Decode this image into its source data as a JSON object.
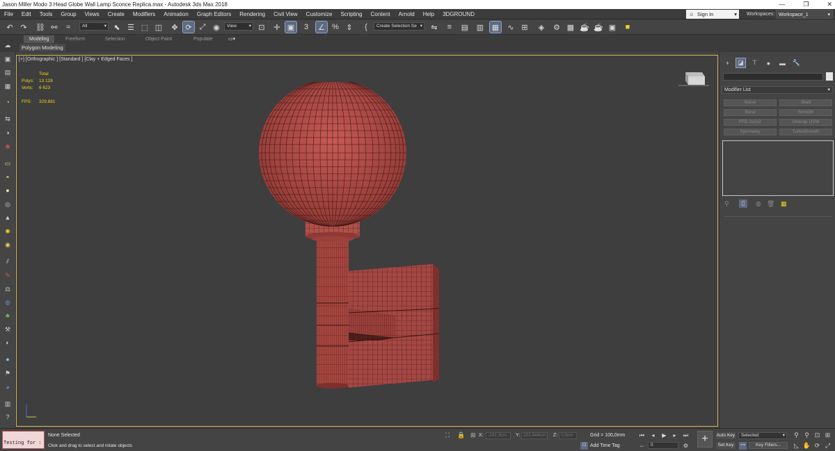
{
  "app": {
    "title": "Jason Miller Modo 3 Head Globe Wall Lamp Sconce Replica.max - Autodesk 3ds Max 2018",
    "window_controls": [
      "—",
      "❐",
      "✕"
    ]
  },
  "menu": [
    "File",
    "Edit",
    "Tools",
    "Group",
    "Views",
    "Create",
    "Modifiers",
    "Animation",
    "Graph Editors",
    "Rendering",
    "Civil View",
    "Customize",
    "Scripting",
    "Content",
    "Arnold",
    "Help",
    "3DGROUND"
  ],
  "account": {
    "signin": "Sign In",
    "workspaces_label": "Workspaces:",
    "workspace": "Workspace_1"
  },
  "toolbar": {
    "filter": "All",
    "refcoord": "View",
    "selection_set": "Create Selection Se",
    "icons": [
      "undo-icon",
      "redo-icon",
      "link-icon",
      "unlink-icon",
      "bind-spacewarp-icon",
      "select-icon",
      "select-by-name-icon",
      "rect-region-icon",
      "window-crossing-icon",
      "select-move-icon",
      "select-rotate-icon",
      "select-scale-icon",
      "placement-icon",
      "pivot-icon",
      "keyboard-shortcut-icon",
      "snap-icon",
      "angle-snap-icon",
      "percent-snap-icon",
      "spinner-snap-icon",
      "edit-named-sets-icon",
      "mirror-icon",
      "align-icon",
      "scene-explorer-icon",
      "layer-explorer-icon",
      "ribbon-icon",
      "curve-editor-icon",
      "schematic-icon",
      "material-editor-icon",
      "render-setup-icon",
      "render-frame-icon",
      "render-icon",
      "arnold-icon"
    ]
  },
  "ribbon": {
    "tabs": [
      "Modeling",
      "Freeform",
      "Selection",
      "Object Paint",
      "Populate"
    ],
    "active": "Modeling",
    "panel": "Polygon Modeling"
  },
  "viewport": {
    "label": "[+] [Orthographic ] [Standard ] [Clay + Edged Faces ]",
    "stats": {
      "header": "Total",
      "polys_label": "Polys:",
      "polys": "13 128",
      "verts_label": "Verts:",
      "verts": "6 623",
      "fps_label": "FPS:",
      "fps": "329,881"
    },
    "model_color": "#a84a45"
  },
  "command_panel": {
    "tabs": [
      "create-icon",
      "modify-icon",
      "hierarchy-icon",
      "motion-icon",
      "display-icon",
      "utilities-icon"
    ],
    "modifier_list": "Modifier List",
    "buttons": [
      "Noise",
      "Shell",
      "Bend",
      "Smooth",
      "FFD 2x2x2",
      "Unwrap UVW",
      "Symmetry",
      "TurboSmooth"
    ]
  },
  "status": {
    "script": "Testing for :",
    "selection": "None Selected",
    "prompt": "Click and drag to select and rotate objects",
    "x_label": "X:",
    "x": "-241,3cm",
    "y_label": "Y:",
    "y": "202,844cm",
    "z_label": "Z:",
    "z": "0,0cm",
    "grid": "Grid = 100,0mm",
    "add_time_tag": "Add Time Tag",
    "frame": "0",
    "auto_key": "Auto Key",
    "set_key": "Set Key",
    "key_set": "Selected",
    "key_filters": "Key Filters..."
  }
}
